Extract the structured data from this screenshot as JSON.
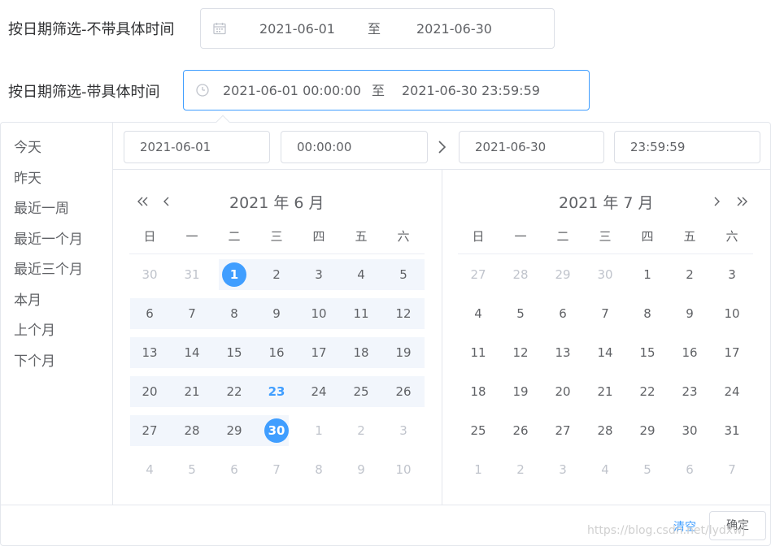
{
  "filter_no_time": {
    "label": "按日期筛选-不带具体时间",
    "start": "2021-06-01",
    "separator": "至",
    "end": "2021-06-30",
    "icon": "calendar-icon"
  },
  "filter_with_time": {
    "label": "按日期筛选-带具体时间",
    "start": "2021-06-01 00:00:00",
    "separator": "至",
    "end": "2021-06-30 23:59:59",
    "icon": "clock-icon"
  },
  "shortcuts": [
    "今天",
    "昨天",
    "最近一周",
    "最近一个月",
    "最近三个月",
    "本月",
    "上个月",
    "下个月"
  ],
  "time_header": {
    "start_date": "2021-06-01",
    "start_time": "00:00:00",
    "end_date": "2021-06-30",
    "end_time": "23:59:59"
  },
  "left_month": {
    "title": "2021 年 6 月",
    "weekdays": [
      "日",
      "一",
      "二",
      "三",
      "四",
      "五",
      "六"
    ],
    "weeks": [
      [
        "30",
        "31",
        "1",
        "2",
        "3",
        "4",
        "5"
      ],
      [
        "6",
        "7",
        "8",
        "9",
        "10",
        "11",
        "12"
      ],
      [
        "13",
        "14",
        "15",
        "16",
        "17",
        "18",
        "19"
      ],
      [
        "20",
        "21",
        "22",
        "23",
        "24",
        "25",
        "26"
      ],
      [
        "27",
        "28",
        "29",
        "30",
        "1",
        "2",
        "3"
      ],
      [
        "4",
        "5",
        "6",
        "7",
        "8",
        "9",
        "10"
      ]
    ]
  },
  "right_month": {
    "title": "2021 年 7 月",
    "weekdays": [
      "日",
      "一",
      "二",
      "三",
      "四",
      "五",
      "六"
    ],
    "weeks": [
      [
        "27",
        "28",
        "29",
        "30",
        "1",
        "2",
        "3"
      ],
      [
        "4",
        "5",
        "6",
        "7",
        "8",
        "9",
        "10"
      ],
      [
        "11",
        "12",
        "13",
        "14",
        "15",
        "16",
        "17"
      ],
      [
        "18",
        "19",
        "20",
        "21",
        "22",
        "23",
        "24"
      ],
      [
        "25",
        "26",
        "27",
        "28",
        "29",
        "30",
        "31"
      ],
      [
        "1",
        "2",
        "3",
        "4",
        "5",
        "6",
        "7"
      ]
    ]
  },
  "footer": {
    "clear_label": "清空",
    "confirm_label": "确定"
  },
  "watermark": "https://blog.csdn.net/lydxwj",
  "colors": {
    "accent": "#409eff",
    "range_bg": "#f2f6fc",
    "muted_text": "#c0c4cc",
    "text": "#606266"
  }
}
